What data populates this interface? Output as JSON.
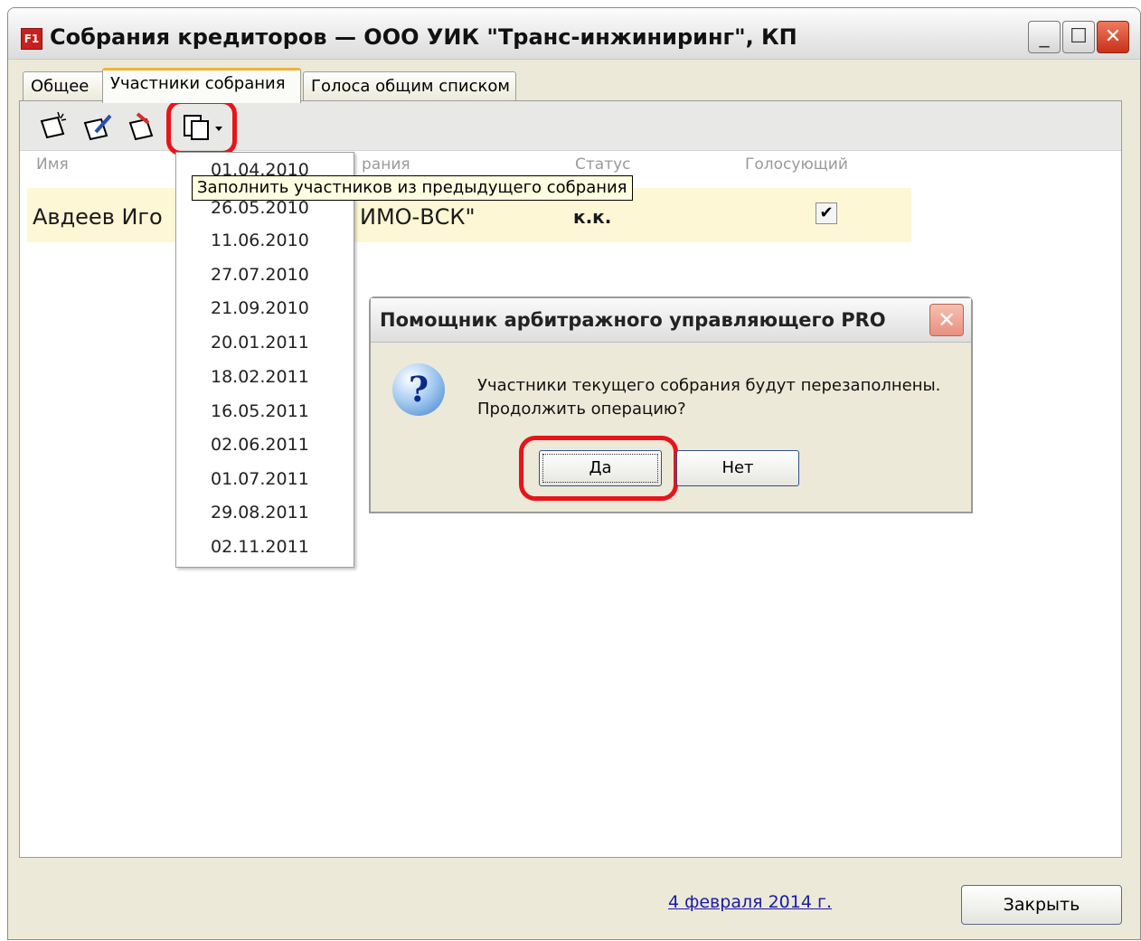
{
  "window": {
    "app_icon_label": "F1",
    "title": "Собрания кредиторов — ООО УИК \"Транс-инжиниринг\", КП",
    "minimize_glyph": "_",
    "maximize_glyph": "☐",
    "close_glyph": "✕"
  },
  "tabs": [
    {
      "label": "Общее"
    },
    {
      "label": "Участники собрания"
    },
    {
      "label": "Голоса общим списком"
    }
  ],
  "table": {
    "columns": [
      "Имя",
      "рания",
      "Статус",
      "Голосующий"
    ],
    "row": {
      "name": "Авдеев Иго",
      "org": "ИМО-ВСК\"",
      "status": "к.к.",
      "voting_mark": "✔"
    }
  },
  "tooltip": "Заполнить участников из предыдущего собрания",
  "dropdown": {
    "items": [
      "01.04.2010",
      "26.05.2010",
      "11.06.2010",
      "27.07.2010",
      "21.09.2010",
      "20.01.2011",
      "18.02.2011",
      "16.05.2011",
      "02.06.2011",
      "01.07.2011",
      "29.08.2011",
      "02.11.2011"
    ]
  },
  "dialog": {
    "title": "Помощник арбитражного управляющего PRO",
    "close_glyph": "✕",
    "icon_glyph": "?",
    "message_line1": "Участники текущего собрания будут перезаполнены.",
    "message_line2": "Продолжить операцию?",
    "yes_label": "Да",
    "no_label": "Нет"
  },
  "footer": {
    "date": "4 февраля 2014 г.",
    "close_label": "Закрыть"
  },
  "colors": {
    "highlight": "#e8141a",
    "row_bg": "#fdf7d6",
    "active_tab_accent": "#f3b33a"
  }
}
